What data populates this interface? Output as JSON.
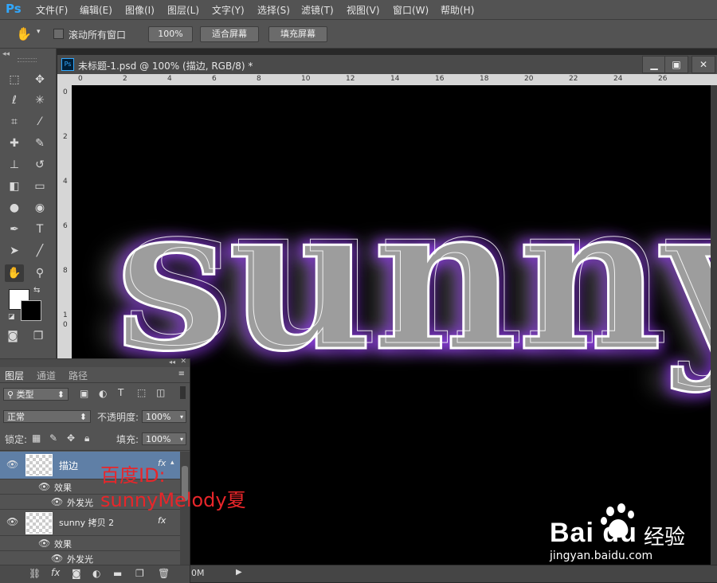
{
  "app": {
    "logo": "Ps"
  },
  "menu": [
    "文件(F)",
    "编辑(E)",
    "图像(I)",
    "图层(L)",
    "文字(Y)",
    "选择(S)",
    "滤镜(T)",
    "视图(V)",
    "窗口(W)",
    "帮助(H)"
  ],
  "options": {
    "scroll_all_label": "滚动所有窗口",
    "zoom_button": "100%",
    "fit_button": "适合屏幕",
    "fill_button": "填充屏幕"
  },
  "document": {
    "tab_title": "未标题-1.psd @ 100% (描边, RGB/8) *",
    "ruler_h": [
      "0",
      "2",
      "4",
      "6",
      "8",
      "10",
      "12",
      "14",
      "16",
      "18",
      "20",
      "22",
      "24",
      "26"
    ],
    "ruler_v": [
      "0",
      "2",
      "4",
      "6",
      "8",
      "1",
      "0"
    ],
    "canvas_text": "sunny",
    "status_text": "0M"
  },
  "layers_panel": {
    "tabs": [
      "图层",
      "通道",
      "路径"
    ],
    "filter_kind": "类型",
    "blend_mode": "正常",
    "opacity_label": "不透明度:",
    "opacity_value": "100%",
    "lock_label": "锁定:",
    "fill_label": "填充:",
    "fill_value": "100%",
    "layers": [
      {
        "name": "描边",
        "selected": true,
        "fx": "fx",
        "effects_label": "效果",
        "effect": "外发光"
      },
      {
        "name": "sunny 拷贝 2",
        "selected": false,
        "fx": "fx",
        "effects_label": "效果",
        "effect": "外发光"
      }
    ]
  },
  "watermark": {
    "line1": "百度ID:",
    "line2": "sunnyMelody夏"
  },
  "baidu": {
    "logo": "Bai du",
    "sub": "经验",
    "url": "jingyan.baidu.com"
  },
  "colors": {
    "accent": "#31a8ff",
    "glow": "#9b3dff",
    "selected_layer": "#5f7fa6"
  }
}
